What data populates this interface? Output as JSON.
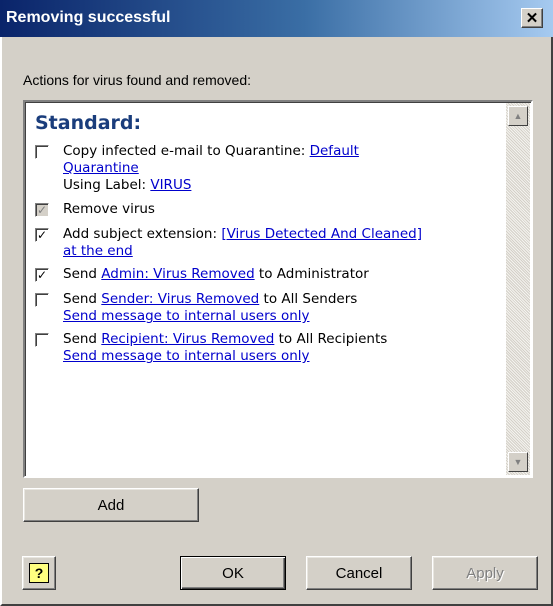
{
  "window": {
    "title": "Removing successful",
    "close_glyph": "✕"
  },
  "section_label": "Actions for virus found and removed:",
  "list": {
    "heading": "Standard:",
    "items": [
      {
        "checked": false,
        "disabled": false,
        "pre": "Copy infected e-mail to Quarantine: ",
        "link1a": "Default",
        "link1b": "Quarantine",
        "line2_pre": "Using Label: ",
        "link2": "VIRUS"
      },
      {
        "checked": true,
        "disabled": true,
        "pre": "Remove virus"
      },
      {
        "checked": true,
        "disabled": false,
        "pre": "Add subject extension: ",
        "link1a": "[Virus Detected And Cleaned]",
        "link1b": "at the end"
      },
      {
        "checked": true,
        "disabled": false,
        "pre": "Send ",
        "link1a": "Admin: Virus Removed",
        "post": " to Administrator"
      },
      {
        "checked": false,
        "disabled": false,
        "pre": "Send ",
        "link1a": "Sender: Virus Removed",
        "post": " to All Senders",
        "link2": "Send message to internal users only"
      },
      {
        "checked": false,
        "disabled": false,
        "pre": "Send ",
        "link1a": "Recipient: Virus Removed",
        "post": " to All Recipients",
        "link2": "Send message to internal users only"
      }
    ],
    "check_glyph": "✓"
  },
  "buttons": {
    "add": "Add",
    "ok": "OK",
    "cancel": "Cancel",
    "apply": "Apply",
    "help_glyph": "?"
  }
}
